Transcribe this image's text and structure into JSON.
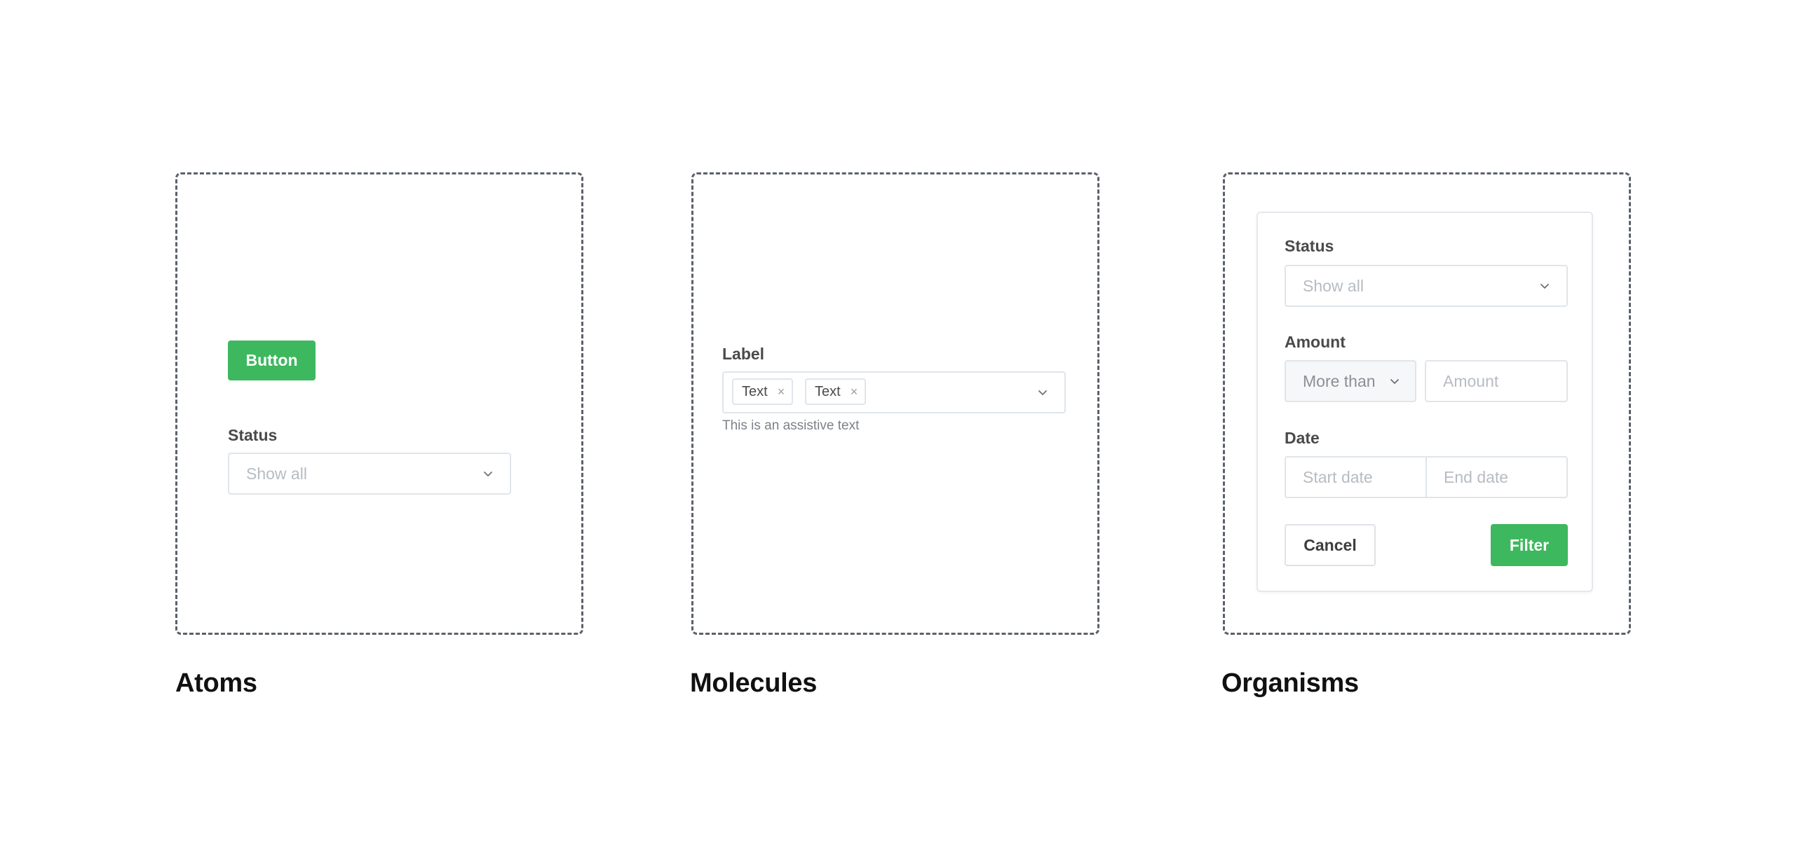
{
  "atoms": {
    "title": "Atoms",
    "button_label": "Button",
    "status_label": "Status",
    "status_placeholder": "Show all"
  },
  "molecules": {
    "title": "Molecules",
    "field_label": "Label",
    "tags": [
      "Text",
      "Text"
    ],
    "tag_remove_glyph": "×",
    "assistive_text": "This is an assistive text"
  },
  "organisms": {
    "title": "Organisms",
    "status_label": "Status",
    "status_placeholder": "Show all",
    "amount_label": "Amount",
    "amount_operator": "More than",
    "amount_placeholder": "Amount",
    "date_label": "Date",
    "start_date_placeholder": "Start date",
    "end_date_placeholder": "End date",
    "cancel_label": "Cancel",
    "filter_label": "Filter"
  },
  "colors": {
    "primary": "#3db85e",
    "frame_dash": "#5b6169",
    "border": "#e0e5ea",
    "placeholder": "#b7bcc2"
  },
  "icons": {
    "chevron": "chevron-down-icon",
    "remove": "close-icon"
  }
}
